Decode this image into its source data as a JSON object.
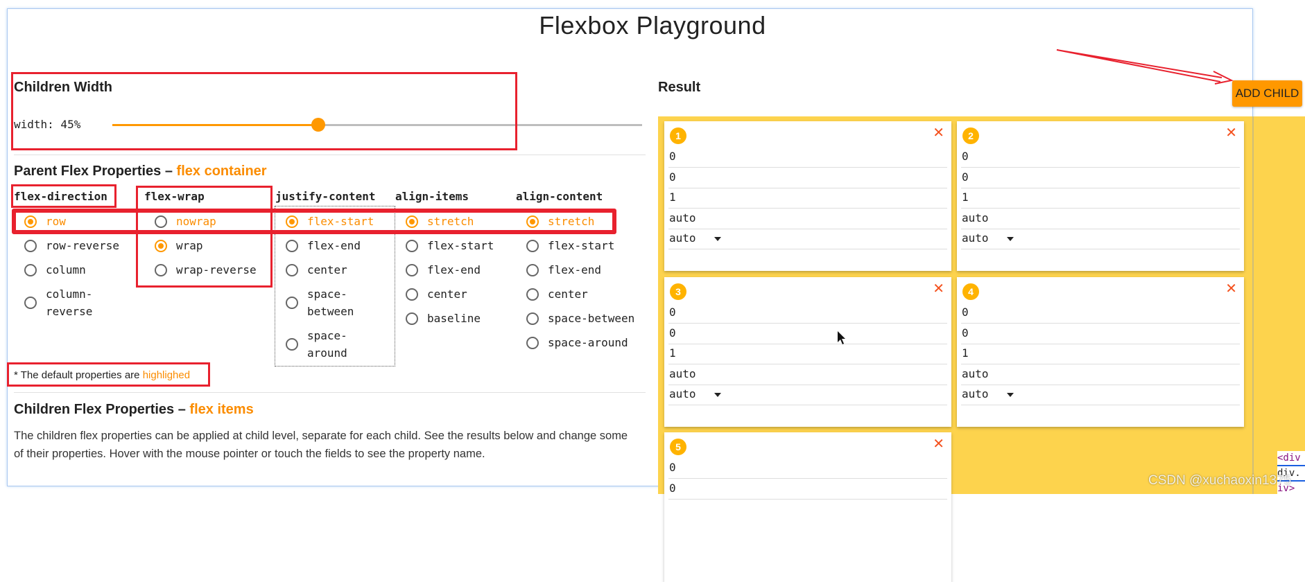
{
  "title": "Flexbox Playground",
  "children_width": {
    "heading": "Children Width",
    "label": "width: 45%",
    "value_percent": 45
  },
  "parent": {
    "heading": "Parent Flex Properties –",
    "heading_accent": "flex container",
    "groups": [
      {
        "name": "flex-direction",
        "options": [
          "row",
          "row-reverse",
          "column",
          "column-reverse"
        ],
        "lines": [
          [
            "row"
          ],
          [
            "row-reverse"
          ],
          [
            "column"
          ],
          [
            "column-",
            "reverse"
          ]
        ],
        "default": 0,
        "selected": 0
      },
      {
        "name": "flex-wrap",
        "options": [
          "nowrap",
          "wrap",
          "wrap-reverse"
        ],
        "lines": [
          [
            "nowrap"
          ],
          [
            "wrap"
          ],
          [
            "wrap-reverse"
          ]
        ],
        "default": 0,
        "selected": 1
      },
      {
        "name": "justify-content",
        "options": [
          "flex-start",
          "flex-end",
          "center",
          "space-between",
          "space-around"
        ],
        "lines": [
          [
            "flex-start"
          ],
          [
            "flex-end"
          ],
          [
            "center"
          ],
          [
            "space-",
            "between"
          ],
          [
            "space-",
            "around"
          ]
        ],
        "default": 0,
        "selected": 0
      },
      {
        "name": "align-items",
        "options": [
          "stretch",
          "flex-start",
          "flex-end",
          "center",
          "baseline"
        ],
        "lines": [
          [
            "stretch"
          ],
          [
            "flex-start"
          ],
          [
            "flex-end"
          ],
          [
            "center"
          ],
          [
            "baseline"
          ]
        ],
        "default": 0,
        "selected": 0
      },
      {
        "name": "align-content",
        "options": [
          "stretch",
          "flex-start",
          "flex-end",
          "center",
          "space-between",
          "space-around"
        ],
        "lines": [
          [
            "stretch"
          ],
          [
            "flex-start"
          ],
          [
            "flex-end"
          ],
          [
            "center"
          ],
          [
            "space-between"
          ],
          [
            "space-around"
          ]
        ],
        "default": 0,
        "selected": 0
      }
    ],
    "note": "* The default properties are",
    "note_accent": "highlighed"
  },
  "children": {
    "heading": "Children Flex Properties –",
    "heading_accent": "flex items",
    "description": "The children flex properties can be applied at child level, separate for each child. See the results below and change some of their properties. Hover with the mouse pointer or touch the fields to see the property name."
  },
  "result": {
    "heading": "Result",
    "add_child_label": "ADD CHILD",
    "close_glyph": "✕",
    "items": [
      {
        "number": "1",
        "fields": [
          "0",
          "0",
          "1",
          "auto",
          "auto"
        ]
      },
      {
        "number": "2",
        "fields": [
          "0",
          "0",
          "1",
          "auto",
          "auto"
        ]
      },
      {
        "number": "3",
        "fields": [
          "0",
          "0",
          "1",
          "auto",
          "auto"
        ]
      },
      {
        "number": "4",
        "fields": [
          "0",
          "0",
          "1",
          "auto",
          "auto"
        ]
      },
      {
        "number": "5",
        "fields": [
          "0",
          "0"
        ]
      }
    ]
  },
  "devtools_snippet": [
    "<div",
    "div.",
    "iv>"
  ],
  "watermark": "CSDN @xuchaoxin1375",
  "colors": {
    "accent": "#ff9800",
    "container": "#fdd34d",
    "annotation": "#e8212e",
    "close": "#f4511e"
  }
}
